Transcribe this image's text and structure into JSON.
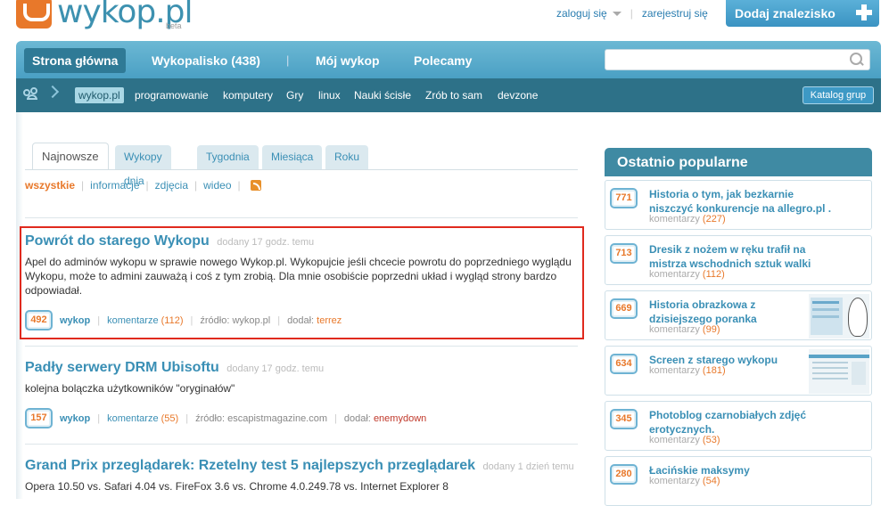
{
  "header": {
    "logo_text": "wykop.pl",
    "logo_beta": "beta",
    "login": "zaloguj się",
    "register": "zarejestruj się",
    "add_button": "Dodaj znalezisko"
  },
  "nav": {
    "items": [
      "Strona główna",
      "Wykopalisko (438)",
      "Mój wykop",
      "Polecamy"
    ]
  },
  "subnav": {
    "tags": [
      "wykop.pl",
      "programowanie",
      "komputery",
      "Gry",
      "linux",
      "Nauki ścisłe",
      "Zrób to sam",
      "devzone"
    ],
    "catalog": "Katalog grup"
  },
  "tabs": [
    "Najnowsze",
    "Wykopy dnia",
    "Tygodnia",
    "Miesiąca",
    "Roku"
  ],
  "filters": [
    "wszystkie",
    "informacje",
    "zdjęcia",
    "wideo"
  ],
  "entries": [
    {
      "title": "Powrót do starego Wykopu",
      "added": "dodany 17 godz. temu",
      "desc": "Apel do adminów wykopu w sprawie nowego Wykop.pl. Wykopujcie jeśli chcecie powrotu do poprzedniego wyglądu Wykopu, może to admini zauważą i coś z tym zrobią. Dla mnie osobiście poprzedni układ i wygląd strony bardzo odpowiadał.",
      "votes": "492",
      "wykop": "wykop",
      "comments_label": "komentarze",
      "comments": "(112)",
      "source": "źródło: wykop.pl",
      "added_by_label": "dodał:",
      "user": "terrez"
    },
    {
      "title": "Padły serwery DRM Ubisoftu",
      "added": "dodany 17 godz. temu",
      "desc": "kolejna bolączka użytkowników \"oryginałów\"",
      "votes": "157",
      "wykop": "wykop",
      "comments_label": "komentarze",
      "comments": "(55)",
      "source": "źródło: escapistmagazine.com",
      "added_by_label": "dodał:",
      "user": "enemydown"
    },
    {
      "title": "Grand Prix przeglądarek: Rzetelny test 5 najlepszych przeglądarek",
      "added": "dodany 1 dzień temu",
      "desc": "Opera 10.50 vs. Safari 4.04 vs. FireFox 3.6 vs. Chrome 4.0.249.78 vs. Internet Explorer 8"
    }
  ],
  "sidebar": {
    "heading": "Ostatnio popularne",
    "comments_label": "komentarzy",
    "items": [
      {
        "votes": "771",
        "title": "Historia o tym, jak bezkarnie niszczyć konkurencje na allegro.pl .",
        "comments": "(227)"
      },
      {
        "votes": "713",
        "title": "Dresik z nożem w ręku trafił na mistrza wschodnich sztuk walki",
        "comments": "(112)"
      },
      {
        "votes": "669",
        "title": "Historia obrazkowa z dzisiejszego poranka",
        "comments": "(99)"
      },
      {
        "votes": "634",
        "title": "Screen z starego wykopu",
        "comments": "(181)"
      },
      {
        "votes": "345",
        "title": "Photoblog czarnobiałych zdjęć erotycznych.",
        "comments": "(53)"
      },
      {
        "votes": "280",
        "title": "Łacińskie maksymy",
        "comments": "(54)"
      }
    ]
  },
  "colors": {
    "accent": "#3a8fb5",
    "orange": "#e8782a",
    "nav": "#4aa0c4",
    "subnav": "#2d7188",
    "highlight": "#e02a1e"
  }
}
